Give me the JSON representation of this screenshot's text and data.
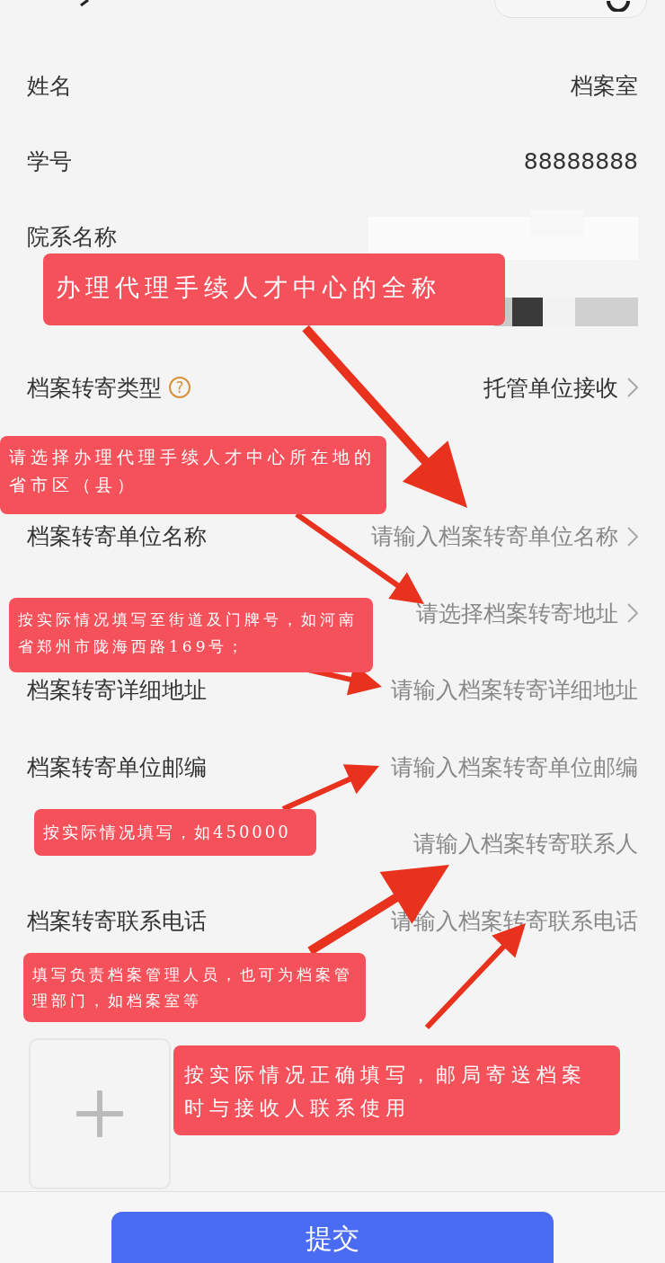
{
  "sections": [
    {
      "rows": [
        {
          "kind": "text",
          "label": "姓名",
          "value": "档案室"
        },
        {
          "kind": "text",
          "label": "学号",
          "value": "88888888"
        },
        {
          "kind": "redacted",
          "label": "院系名称"
        },
        {
          "kind": "redacted"
        },
        {
          "kind": "select",
          "label": "档案转寄类型",
          "help": "?",
          "value": "托管单位接收"
        }
      ]
    },
    {
      "rows": [
        {
          "kind": "select",
          "label": "档案转寄单位名称",
          "placeholder": "请输入档案转寄单位名称"
        },
        {
          "kind": "select",
          "placeholder": "请选择档案转寄地址"
        },
        {
          "kind": "input",
          "label": "档案转寄详细地址",
          "placeholder": "请输入档案转寄详细地址"
        },
        {
          "kind": "input",
          "label": "档案转寄单位邮编",
          "placeholder": "请输入档案转寄单位邮编"
        },
        {
          "kind": "input",
          "placeholder": "请输入档案转寄联系人"
        },
        {
          "kind": "input",
          "label": "档案转寄联系电话",
          "placeholder": "请输入档案转寄联系电话"
        }
      ]
    }
  ],
  "submit": "提交",
  "annotations": [
    {
      "text": "办理代理手续人才中心的全称"
    },
    {
      "text": "请选择办理代理手续人才中心所在地的省市区（县）"
    },
    {
      "text": "按实际情况填写至街道及门牌号，如河南省郑州市陇海西路169号；"
    },
    {
      "text": "按实际情况填写，如450000"
    },
    {
      "text": "填写负责档案管理人员，也可为档案管理部门，如档案室等"
    },
    {
      "text": "按实际情况正确填写，邮局寄送档案时与接收人联系使用"
    }
  ]
}
